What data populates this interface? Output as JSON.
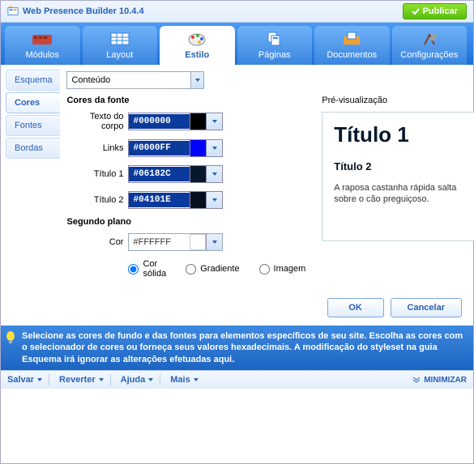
{
  "app": {
    "title": "Web Presence Builder 10.4.4",
    "publish": "Publicar"
  },
  "tabs": {
    "modules": "Módulos",
    "layout": "Layout",
    "style": "Estilo",
    "pages": "Páginas",
    "documents": "Documentos",
    "settings": "Configurações"
  },
  "sidebar": {
    "scheme": "Esquema",
    "colors": "Cores",
    "fonts": "Fontes",
    "borders": "Bordas"
  },
  "dropdown": {
    "value": "Conteúdo"
  },
  "sections": {
    "font_colors": "Cores da fonte",
    "background": "Segundo plano",
    "preview": "Pré-visualização"
  },
  "fields": {
    "body_text": {
      "label": "Texto do corpo",
      "value": "#000000",
      "swatch": "#000000"
    },
    "links": {
      "label": "Links",
      "value": "#0000FF",
      "swatch": "#0000FF"
    },
    "title1": {
      "label": "Título 1",
      "value": "#06182C",
      "swatch": "#06182C"
    },
    "title2": {
      "label": "Título 2",
      "value": "#04101E",
      "swatch": "#04101E"
    },
    "bg_color": {
      "label": "Cor",
      "value": "#FFFFFF",
      "swatch": "#FFFFFF"
    }
  },
  "radios": {
    "solid": "Cor sólida",
    "gradient": "Gradiente",
    "image": "Imagem"
  },
  "preview": {
    "h1": "Título 1",
    "h2": "Título 2",
    "body": "A raposa castanha rápida salta sobre o cão preguiçoso."
  },
  "buttons": {
    "ok": "OK",
    "cancel": "Cancelar"
  },
  "hint": "Selecione as cores de fundo e das fontes para elementos específicos de seu site. Escolha as cores com o selecionador de cores ou forneça seus valores hexadecimais. A modificação do styleset na guia Esquema irá ignorar as alterações efetuadas aqui.",
  "footer": {
    "save": "Salvar",
    "revert": "Reverter",
    "help": "Ajuda",
    "more": "Mais",
    "minimize": "MINIMIZAR"
  }
}
